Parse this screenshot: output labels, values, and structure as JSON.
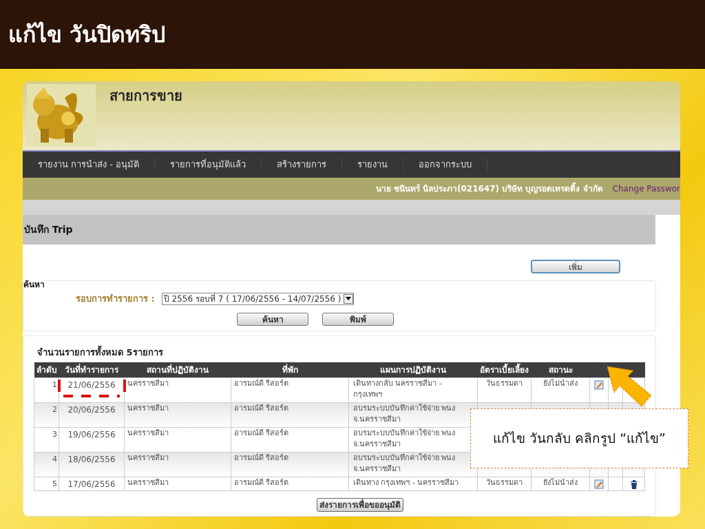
{
  "slide_title": "แก้ไข วันปิดทริป",
  "app": {
    "title": "สายการขาย",
    "nav": [
      "รายงาน การนำส่ง - อนุมัติ",
      "รายการที่อนุมัติแล้ว",
      "สร้างรายการ",
      "รายงาน",
      "ออกจากระบบ"
    ],
    "user": "นาย ชนินทร์ นิลประภา(021647) บริษัท บุญรอดเทรดดิ้ง จำกัด",
    "change_password": "Change Passwor",
    "section_title": "บันทึก Trip",
    "add_button": "เพิ่ม",
    "search": {
      "legend": "ค้นหา",
      "label": "รอบการทำรายการ :",
      "value": "ปี 2556 รอบที่ 7 ( 17/06/2556 - 14/07/2556 )",
      "buttons": [
        "ค้นหา",
        "พิมพ์"
      ]
    },
    "summary": "จำนวนรายการทั้งหมด 5รายการ",
    "table": {
      "columns": [
        "ลำดับ",
        "วันที่ทำรายการ",
        "สถานที่ปฏิบัติงาน",
        "ที่พัก",
        "แผนการปฏิบัติงาน",
        "อัตราเบี้ยเลี้ยง",
        "สถานะ"
      ],
      "rows": [
        {
          "no": "1",
          "date": "21/06/2556",
          "place": "นครราชสีมา",
          "lodging": "อารมณ์ดี รีสอร์ต",
          "plan": "เดินทางกลับ นครราชสีมา - กรุงเทพฯ",
          "rate": "วันธรรมดา",
          "status": "ยังไม่นำส่ง",
          "highlighted": true,
          "edit_icon": true,
          "delete_icon": false
        },
        {
          "no": "2",
          "date": "20/06/2556",
          "place": "นครราชสีมา",
          "lodging": "อารมณ์ดี รีสอร์ต",
          "plan": "อบรมระบบบันทึกค่าใช้จ่าย พนง จ.นครราชสีมา",
          "highlighted": false,
          "edit_icon": false,
          "delete_icon": false
        },
        {
          "no": "3",
          "date": "19/06/2556",
          "place": "นครราชสีมา",
          "lodging": "อารมณ์ดี รีสอร์ต",
          "plan": "อบรมระบบบันทึกค่าใช้จ่าย พนง จ.นครราชสีมา",
          "highlighted": false,
          "edit_icon": false,
          "delete_icon": false
        },
        {
          "no": "4",
          "date": "18/06/2556",
          "place": "นครราชสีมา",
          "lodging": "อารมณ์ดี รีสอร์ต",
          "plan": "อบรมระบบบันทึกค่าใช้จ่าย พนง จ.นครราชสีมา",
          "highlighted": false,
          "edit_icon": false,
          "delete_icon": false
        },
        {
          "no": "5",
          "date": "17/06/2556",
          "place": "นครราชสีมา",
          "lodging": "อารมณ์ดี รีสอร์ต",
          "plan": "เดินทาง กรุงเทพฯ - นครราชสีมา",
          "rate": "วันธรรมดา",
          "status": "ยังไม่นำส่ง",
          "highlighted": false,
          "edit_icon": true,
          "delete_icon": true
        }
      ]
    },
    "submit_button": "ส่งรายการเพื่อขออนุมัติ"
  },
  "callout": "แก้ไข วันกลับ คลิกรูป “แก้ไข”"
}
